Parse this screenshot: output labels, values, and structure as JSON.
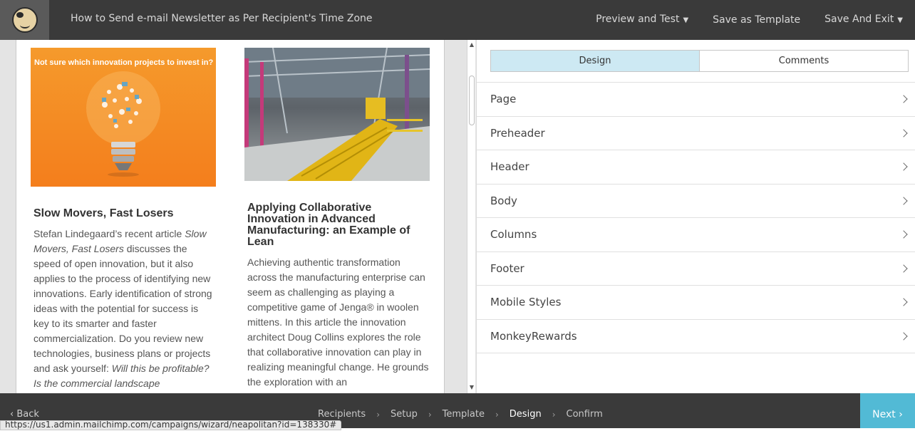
{
  "header": {
    "title": "How to Send e-mail Newsletter as Per Recipient's Time Zone",
    "actions": [
      {
        "label": "Preview and Test",
        "has_caret": true
      },
      {
        "label": "Save as Template",
        "has_caret": false
      },
      {
        "label": "Save And Exit",
        "has_caret": true
      }
    ]
  },
  "email": {
    "left": {
      "image_caption": "Not sure which innovation projects to invest in?",
      "title": "Slow Movers, Fast Losers",
      "body_intro": "Stefan Lindegaard’s recent article ",
      "body_em1": "Slow Movers, Fast Losers",
      "body_mid": " discusses the speed of open innovation, but it also applies to the process of identifying new innovations. Early identification of strong ideas with the potential for success is key to its smarter and faster commercialization. Do you review new technologies, business plans or projects and ask yourself: ",
      "body_em2": "Will this be profitable? Is the commercial landscape"
    },
    "right": {
      "title": "Applying Collaborative Innovation in Advanced Manufacturing: an Example of Lean",
      "body": "Achieving authentic transformation across the manufacturing enterprise can seem as challenging as playing a competitive game of Jenga® in woolen mittens. In this article the innovation architect Doug Collins explores the role that collaborative innovation can play in realizing meaningful change. He grounds the exploration with an"
    }
  },
  "panel": {
    "tabs": [
      {
        "label": "Design",
        "active": true
      },
      {
        "label": "Comments",
        "active": false
      }
    ],
    "sections": [
      "Page",
      "Preheader",
      "Header",
      "Body",
      "Columns",
      "Footer",
      "Mobile Styles",
      "MonkeyRewards"
    ]
  },
  "footer": {
    "back_label": "Back",
    "steps": [
      "Recipients",
      "Setup",
      "Template",
      "Design",
      "Confirm"
    ],
    "current_step": "Design",
    "next_label": "Next"
  },
  "status_url": "https://us1.admin.mailchimp.com/campaigns/wizard/neapolitan?id=138330#",
  "colors": {
    "topbar": "#3a3a3a",
    "accent": "#52bad5",
    "active_tab": "#cde9f3"
  }
}
